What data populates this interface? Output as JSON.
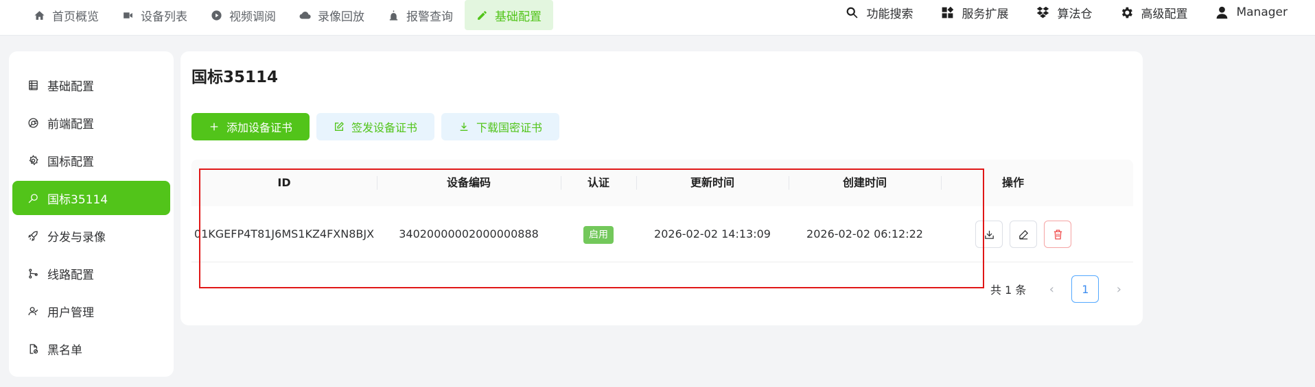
{
  "nav": {
    "left": [
      {
        "label": "首页概览",
        "icon": "home-icon"
      },
      {
        "label": "设备列表",
        "icon": "camera-icon"
      },
      {
        "label": "视频调阅",
        "icon": "play-icon"
      },
      {
        "label": "录像回放",
        "icon": "cloud-icon"
      },
      {
        "label": "报警查询",
        "icon": "siren-icon"
      },
      {
        "label": "基础配置",
        "icon": "edit-icon",
        "active": true
      }
    ],
    "right": [
      {
        "label": "功能搜索",
        "icon": "search-icon"
      },
      {
        "label": "服务扩展",
        "icon": "grid-icon"
      },
      {
        "label": "算法仓",
        "icon": "dropbox-icon"
      },
      {
        "label": "高级配置",
        "icon": "gear-icon"
      },
      {
        "label": "Manager",
        "icon": "user-icon"
      }
    ]
  },
  "sidebar": {
    "items": [
      {
        "label": "基础配置",
        "icon": "list-icon"
      },
      {
        "label": "前端配置",
        "icon": "chrome-icon"
      },
      {
        "label": "国标配置",
        "icon": "settings-icon"
      },
      {
        "label": "国标35114",
        "icon": "search-icon",
        "active": true
      },
      {
        "label": "分发与录像",
        "icon": "rocket-icon"
      },
      {
        "label": "线路配置",
        "icon": "branch-icon"
      },
      {
        "label": "用户管理",
        "icon": "users-icon"
      },
      {
        "label": "黑名单",
        "icon": "file-block-icon"
      }
    ]
  },
  "main": {
    "title": "国标35114",
    "buttons": {
      "add": "添加设备证书",
      "sign": "签发设备证书",
      "download": "下载国密证书"
    },
    "table": {
      "headers": {
        "id": "ID",
        "code": "设备编码",
        "auth": "认证",
        "updated": "更新时间",
        "created": "创建时间",
        "ops": "操作"
      },
      "rows": [
        {
          "id": "01KGEFP4T81J6MS1KZ4FXN8BJX",
          "code": "34020000002000000888",
          "auth": "启用",
          "updated": "2026-02-02 14:13:09",
          "created": "2026-02-02 06:12:22"
        }
      ]
    },
    "pagination": {
      "total": "共 1 条",
      "current": "1",
      "prev": "‹",
      "next": "›"
    }
  },
  "colors": {
    "accent": "#52c41a",
    "danger": "#f04848",
    "highlight": "#e01616"
  }
}
